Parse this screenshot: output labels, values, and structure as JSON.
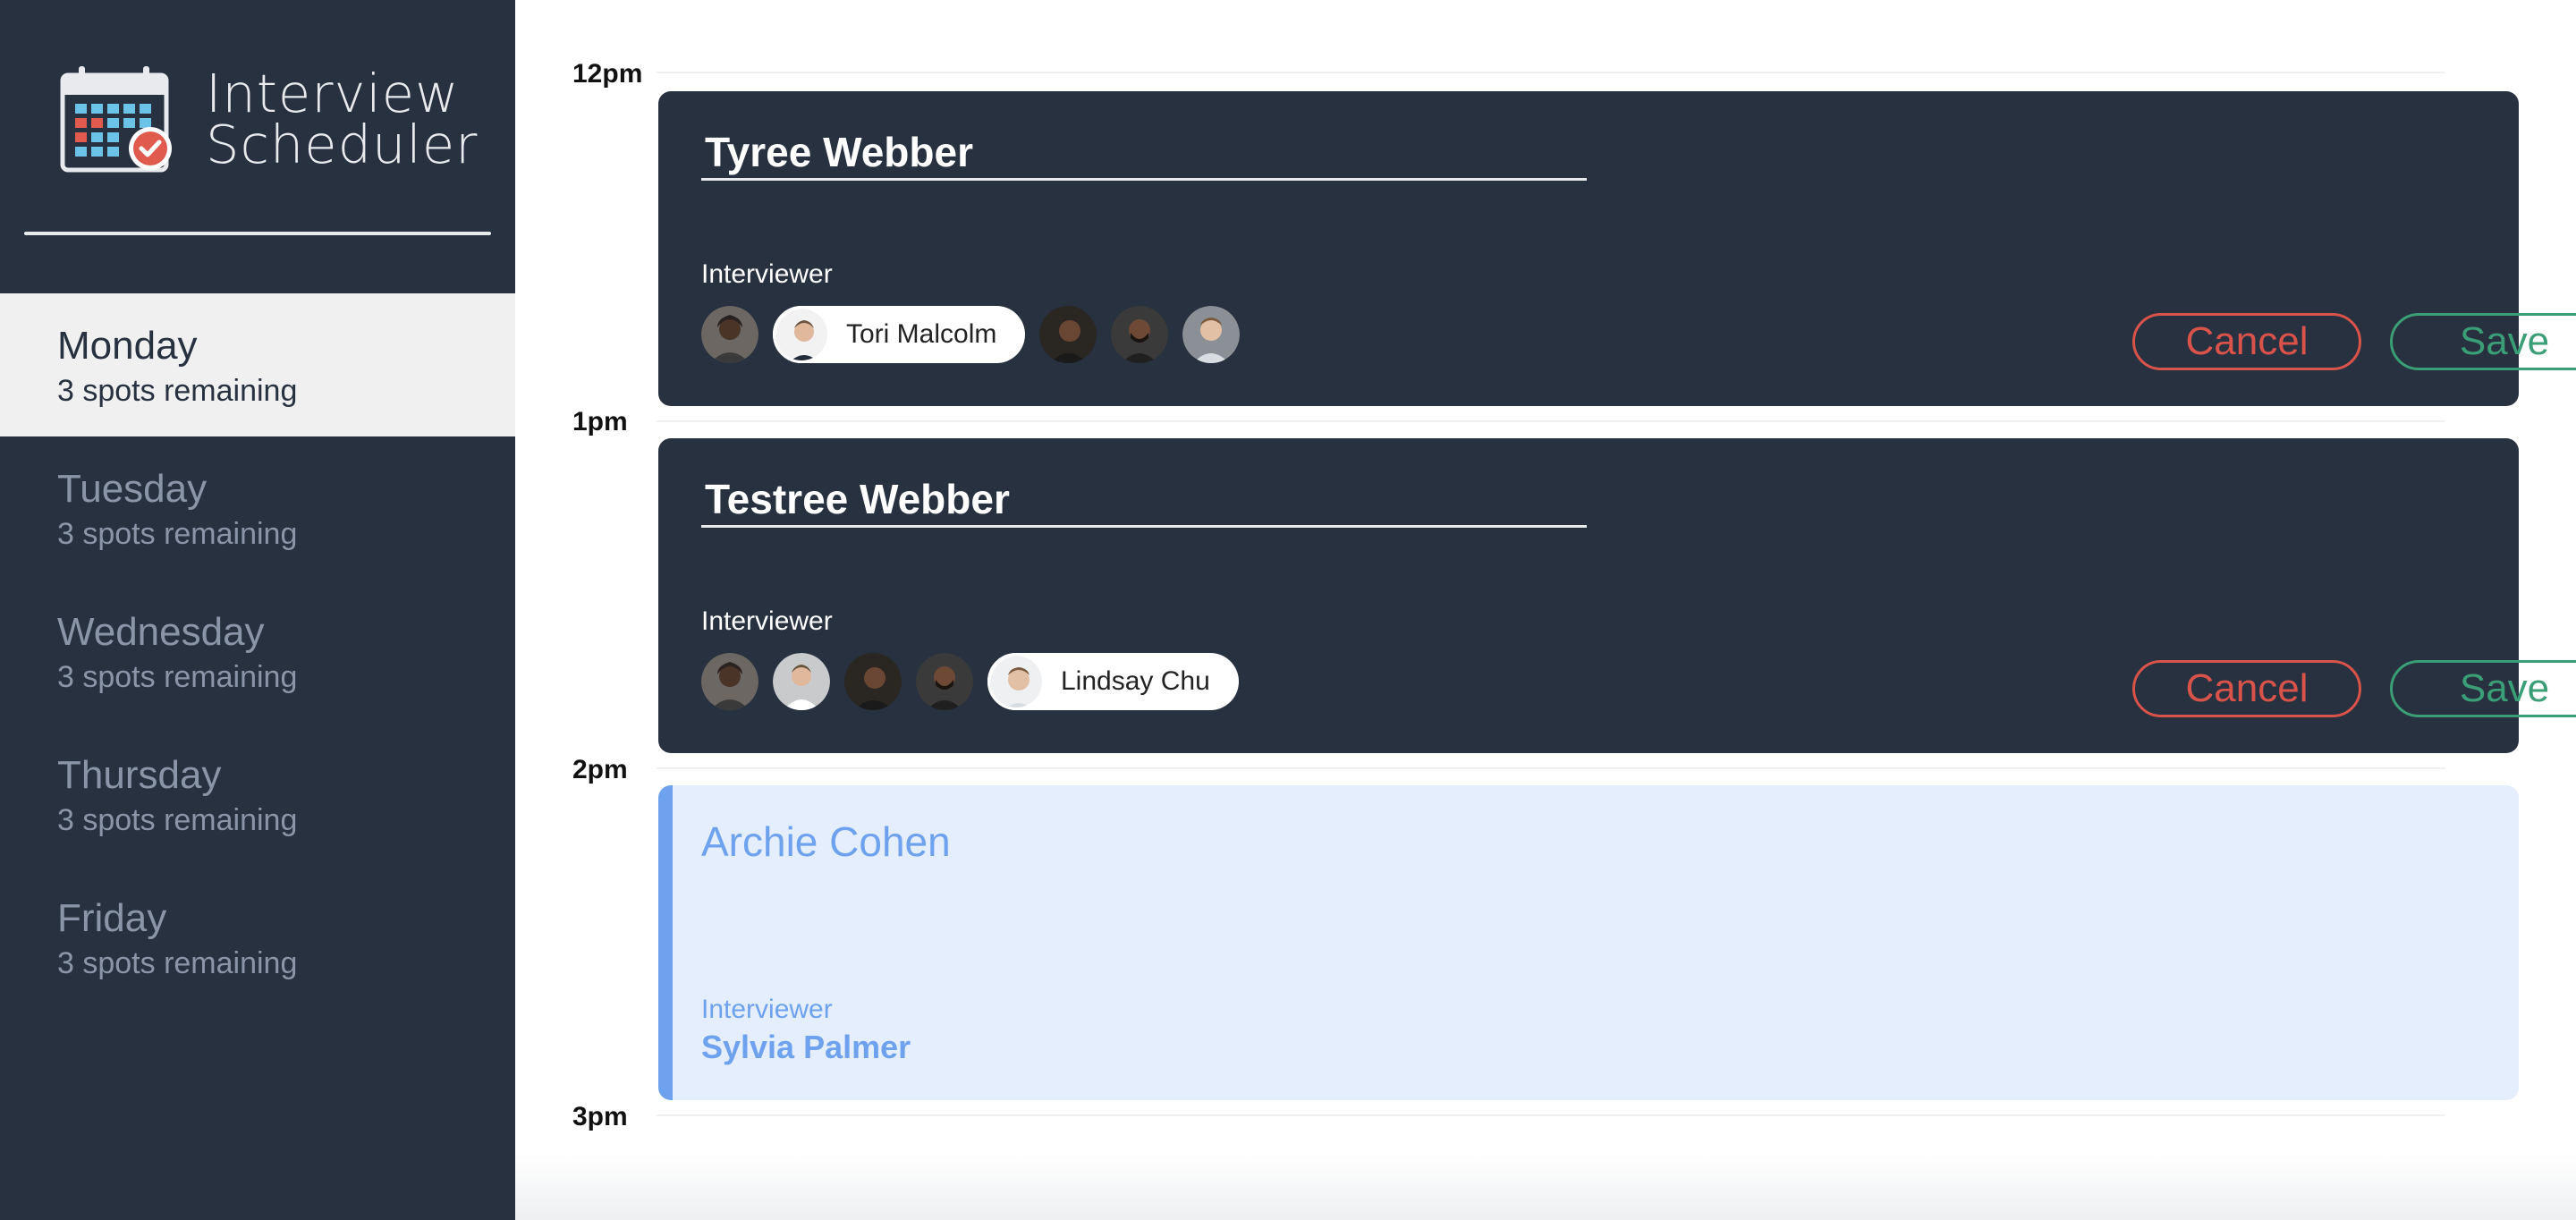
{
  "app": {
    "title_line1": "Interview",
    "title_line2": "Scheduler",
    "logo_icon": "calendar-check-icon"
  },
  "sidebar": {
    "days": [
      {
        "name": "Monday",
        "spots": "3 spots remaining",
        "selected": true
      },
      {
        "name": "Tuesday",
        "spots": "3 spots remaining",
        "selected": false
      },
      {
        "name": "Wednesday",
        "spots": "3 spots remaining",
        "selected": false
      },
      {
        "name": "Thursday",
        "spots": "3 spots remaining",
        "selected": false
      },
      {
        "name": "Friday",
        "spots": "3 spots remaining",
        "selected": false
      }
    ]
  },
  "schedule": {
    "times": [
      "12pm",
      "1pm",
      "2pm",
      "3pm"
    ],
    "appointments": [
      {
        "student": "Tyree Webber",
        "interviewer_label": "Interviewer",
        "selected_interviewer": "Tori Malcolm",
        "cancel_label": "Cancel",
        "save_label": "Save"
      },
      {
        "student": "Testree Webber",
        "interviewer_label": "Interviewer",
        "selected_interviewer": "Lindsay Chu",
        "cancel_label": "Cancel",
        "save_label": "Save"
      },
      {
        "student": "Archie Cohen",
        "interviewer_label": "Interviewer",
        "interviewer": "Sylvia Palmer"
      }
    ]
  },
  "colors": {
    "sidebar_bg": "#283140",
    "card_bg": "#283140",
    "cancel": "#d9534a",
    "save": "#3a9e76",
    "booked_accent": "#6ea2ee",
    "booked_bg": "#e4eefc"
  }
}
